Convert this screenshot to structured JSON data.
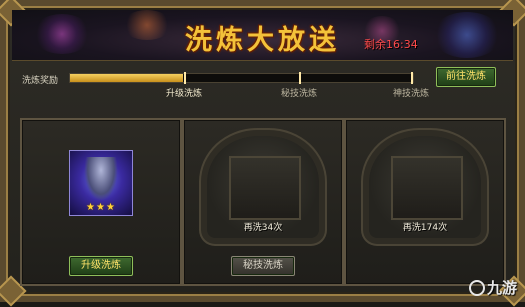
{
  "banner": {
    "title": "洗炼大放送",
    "timer": "剩余16:34"
  },
  "progress": {
    "label": "洗炼奖励",
    "fraction": 0.33,
    "milestones": [
      {
        "label": "升级洗炼"
      },
      {
        "label": "秘技洗炼"
      },
      {
        "label": "神技洗炼"
      }
    ],
    "go_button": "前往洗炼"
  },
  "slots": [
    {
      "stars": "★★★",
      "button": "升级洗炼"
    },
    {
      "count_text": "再洗34次",
      "button": "秘技洗炼"
    },
    {
      "count_text": "再洗174次"
    }
  ],
  "watermark": {
    "text": "九游"
  }
}
